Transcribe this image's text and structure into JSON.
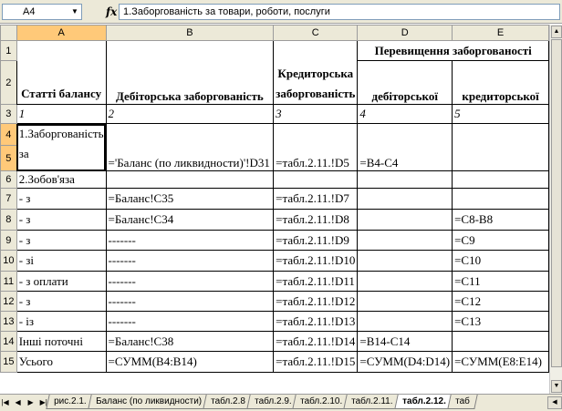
{
  "formula_bar": {
    "name_box": "A4",
    "fx_label": "fx",
    "formula": "1.Заборгованість за товари, роботи, послуги"
  },
  "columns": [
    "A",
    "B",
    "C",
    "D",
    "E"
  ],
  "rows": {
    "r1": {
      "num": "1",
      "D": "Перевищення заборгованості"
    },
    "r2": {
      "num": "2",
      "A": "Статті балансу",
      "B": "Дебіторська заборгованість",
      "C": "Кредиторська заборгованість",
      "D": "дебіторської",
      "E": "кредиторської"
    },
    "r3": {
      "num": "3",
      "A": "1",
      "B": "2",
      "C": "3",
      "D": "4",
      "E": "5"
    },
    "r4": {
      "num": "4",
      "A": "1.Заборгованість за"
    },
    "r5": {
      "num": "5",
      "B": "='Баланс (по ликвидности)'!D31",
      "C": "=табл.2.11.!D5",
      "D": "=B4-C4"
    },
    "r6": {
      "num": "6",
      "A": "2.Зобов'яза"
    },
    "r7": {
      "num": "7",
      "A": "- з",
      "B": "=Баланс!C35",
      "C": "=табл.2.11.!D7"
    },
    "r8": {
      "num": "8",
      "A": "- з",
      "B": "=Баланс!C34",
      "C": "=табл.2.11.!D8",
      "E": "=C8-B8"
    },
    "r9": {
      "num": "9",
      "A": "- з",
      "B": "-------",
      "C": "=табл.2.11.!D9",
      "E": "=C9"
    },
    "r10": {
      "num": "10",
      "A": "- зі",
      "B": "-------",
      "C": "=табл.2.11.!D10",
      "E": "=C10"
    },
    "r11": {
      "num": "11",
      "A": "- з оплати",
      "B": "-------",
      "C": "=табл.2.11.!D11",
      "E": "=C11"
    },
    "r12": {
      "num": "12",
      "A": "- з",
      "B": "-------",
      "C": "=табл.2.11.!D12",
      "E": "=C12"
    },
    "r13": {
      "num": "13",
      "A": "- із",
      "B": "-------",
      "C": "=табл.2.11.!D13",
      "E": "=C13"
    },
    "r14": {
      "num": "14",
      "A": "Інші поточні",
      "B": "=Баланс!C38",
      "C": "=табл.2.11.!D14",
      "D": "=B14-C14"
    },
    "r15": {
      "num": "15",
      "A": "Усього",
      "B": "=СУММ(B4:B14)",
      "C": "=табл.2.11.!D15",
      "D": "=СУММ(D4:D14)",
      "E": "=СУММ(E8:E14)"
    }
  },
  "sheet_tabs": [
    {
      "label": "рис.2.1."
    },
    {
      "label": "Баланс (по ликвидности)"
    },
    {
      "label": "табл.2.8"
    },
    {
      "label": "табл.2.9."
    },
    {
      "label": "табл.2.10."
    },
    {
      "label": "табл.2.11."
    },
    {
      "label": "табл.2.12.",
      "active": true
    },
    {
      "label": "таб"
    }
  ]
}
